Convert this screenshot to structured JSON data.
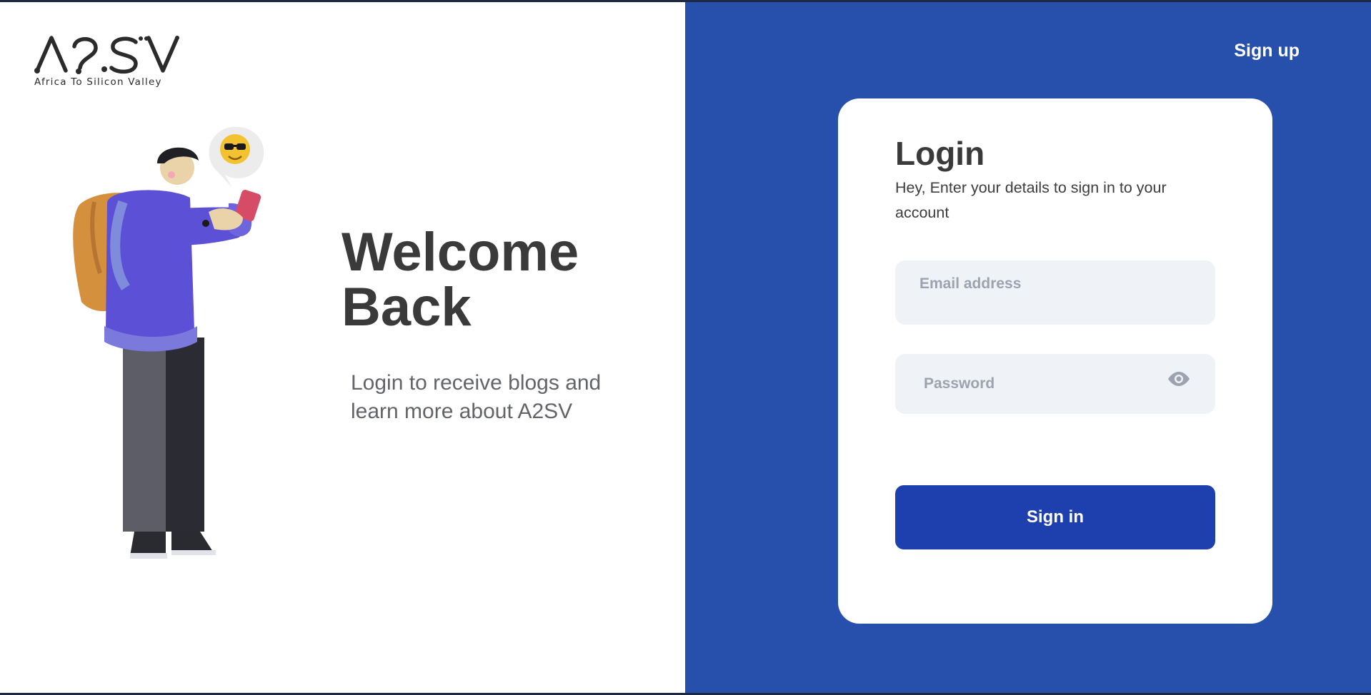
{
  "brand": {
    "tagline": "Africa To Silicon Valley",
    "accent_color": "#2750ad",
    "button_color": "#1e40af"
  },
  "hero": {
    "title": "Welcome\nBack",
    "subtitle": "Login to receive blogs and learn more about A2SV"
  },
  "header": {
    "signup_label": "Sign up"
  },
  "login_card": {
    "title": "Login",
    "subtitle": "Hey, Enter your details to sign in to your account",
    "email": {
      "placeholder": "Email address",
      "value": ""
    },
    "password": {
      "placeholder": "Password",
      "value": "",
      "toggle_icon": "eye-icon"
    },
    "submit_label": "Sign in"
  }
}
